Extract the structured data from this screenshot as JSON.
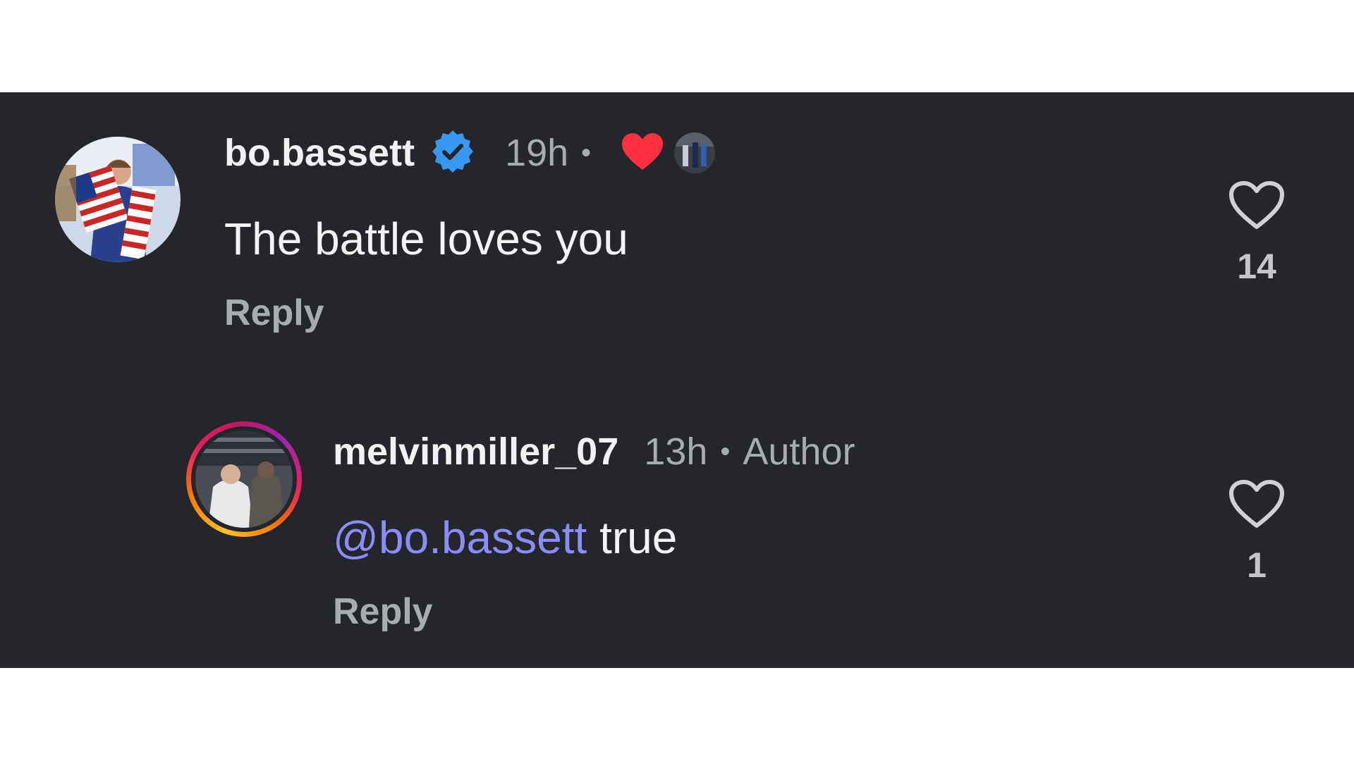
{
  "comments": [
    {
      "username": "bo.bassett",
      "verified": true,
      "time": "19h",
      "separator": "•",
      "liked_by_author": true,
      "text": "The battle loves you",
      "reply_label": "Reply",
      "like_count": "14",
      "icons": {
        "verified": "verified-badge-icon",
        "heart": "heart-filled-icon",
        "like": "heart-outline-icon"
      }
    },
    {
      "username": "melvinmiller_07",
      "time": "13h",
      "separator": "•",
      "author_label": "Author",
      "mention": "@bo.bassett",
      "text": "true",
      "reply_label": "Reply",
      "like_count": "1",
      "icons": {
        "like": "heart-outline-icon"
      }
    }
  ],
  "colors": {
    "background": "#24262b",
    "verified": "#3897f0",
    "heart": "#ff3040",
    "mention": "#8b8cf8"
  }
}
